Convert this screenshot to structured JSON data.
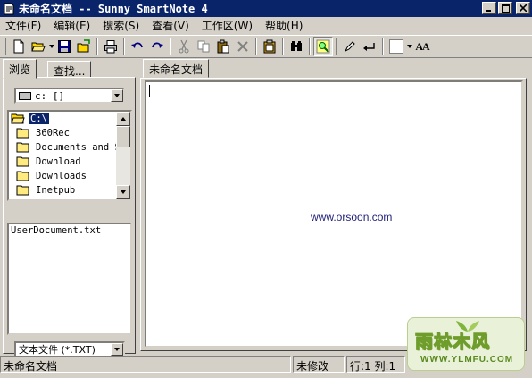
{
  "window": {
    "title": "未命名文档 -- Sunny SmartNote 4",
    "minimize": "_",
    "maximize": "□",
    "close": "×"
  },
  "menu": [
    {
      "label": "文件(F)"
    },
    {
      "label": "编辑(E)"
    },
    {
      "label": "搜索(S)"
    },
    {
      "label": "查看(V)"
    },
    {
      "label": "工作区(W)"
    },
    {
      "label": "帮助(H)"
    }
  ],
  "toolbar": {
    "icons": [
      "new-file-icon",
      "open-folder-icon",
      "save-icon",
      "open-project-icon",
      "print-icon",
      "undo-icon",
      "redo-icon",
      "cut-icon",
      "copy-icon",
      "paste-icon",
      "delete-icon",
      "clipboard-icon",
      "find-icon",
      "find-replace-icon",
      "pen-icon",
      "word-wrap-icon",
      "color-picker-icon",
      "font-icon"
    ],
    "font_label": "AA"
  },
  "left_panel": {
    "tabs": [
      {
        "label": "浏览"
      },
      {
        "label": "查找..."
      }
    ],
    "drive": "c: []",
    "folders": [
      {
        "name": "C:\\",
        "open": true,
        "selected": true
      },
      {
        "name": "360Rec"
      },
      {
        "name": "Documents and S"
      },
      {
        "name": "Download"
      },
      {
        "name": "Downloads"
      },
      {
        "name": "Inetpub"
      }
    ],
    "files": [
      "UserDocument.txt"
    ],
    "filter": "文本文件 (*.TXT)"
  },
  "editor": {
    "tab": "未命名文档",
    "watermark": "www.orsoon.com"
  },
  "statusbar": {
    "doc": "未命名文档",
    "state": "未修改",
    "position": "行:1 列:1"
  },
  "logo": {
    "text": "雨林木风",
    "sub": "WWW.YLMFU.COM"
  }
}
